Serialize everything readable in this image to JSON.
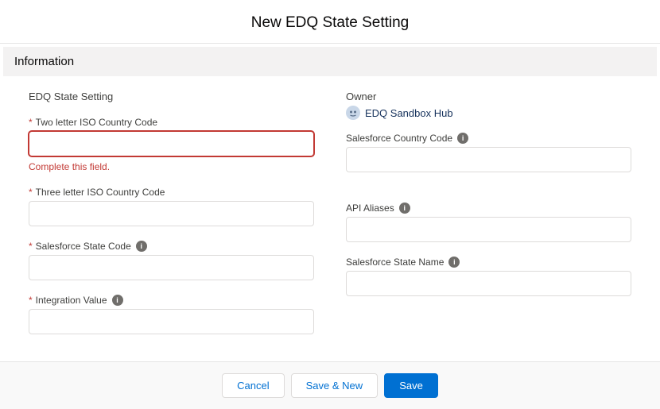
{
  "header": {
    "title": "New EDQ State Setting"
  },
  "section": {
    "label": "Information"
  },
  "left_subhead": "EDQ State Setting",
  "owner": {
    "label": "Owner",
    "value": "EDQ Sandbox Hub"
  },
  "fields": {
    "two_letter": {
      "label": "Two letter ISO Country Code",
      "value": "",
      "error": "Complete this field."
    },
    "sf_country": {
      "label": "Salesforce Country Code",
      "value": ""
    },
    "three_letter": {
      "label": "Three letter ISO Country Code",
      "value": ""
    },
    "api_aliases": {
      "label": "API Aliases",
      "value": ""
    },
    "sf_state_code": {
      "label": "Salesforce State Code",
      "value": ""
    },
    "sf_state_name": {
      "label": "Salesforce State Name",
      "value": ""
    },
    "integration_value": {
      "label": "Integration Value",
      "value": ""
    }
  },
  "buttons": {
    "cancel": "Cancel",
    "save_new": "Save & New",
    "save": "Save"
  }
}
